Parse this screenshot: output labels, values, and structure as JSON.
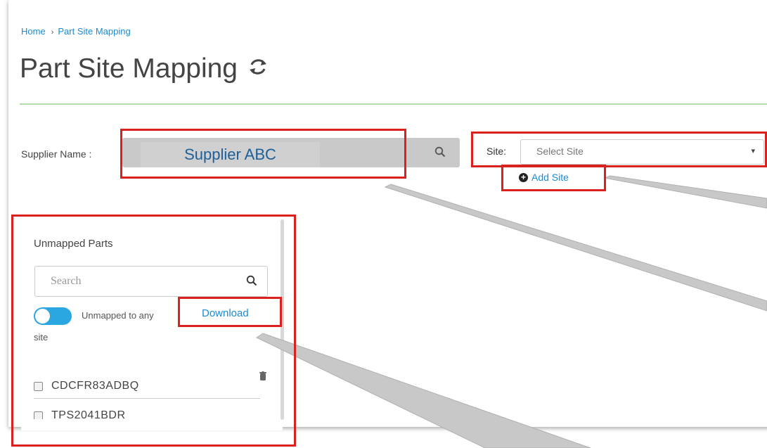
{
  "breadcrumb": {
    "home": "Home",
    "separator": "›",
    "current": "Part Site Mapping"
  },
  "page": {
    "title": "Part Site Mapping",
    "refresh_icon": "refresh-icon"
  },
  "supplier": {
    "label": "Supplier Name :",
    "value": "Supplier ABC",
    "icon": "search-icon"
  },
  "site": {
    "label": "Site:",
    "selected": "Select Site",
    "caret": "▾",
    "add_label": "Add Site"
  },
  "unmapped_panel": {
    "title": "Unmapped Parts",
    "search_placeholder": "Search",
    "toggle_on": true,
    "toggle_label_line1": "Unmapped to any",
    "toggle_label_line2": "site",
    "download_label": "Download",
    "parts": [
      {
        "name": "CDCFR83ADBQ",
        "checked": false
      },
      {
        "name": "TPS2041BDR",
        "checked": false
      }
    ]
  },
  "colors": {
    "link": "#1b8ad3",
    "annotation": "#d9211e",
    "toggle": "#2aa6e0",
    "divider": "#b5dbb1"
  }
}
